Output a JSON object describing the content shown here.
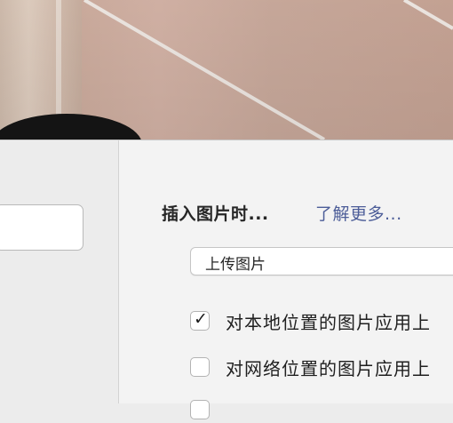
{
  "insert_image": {
    "heading": "插入图片时...",
    "learn_more": "了解更多..."
  },
  "upload_select": {
    "value": "上传图片"
  },
  "checkboxes": [
    {
      "label": "对本地位置的图片应用上",
      "checked": true
    },
    {
      "label": "对网络位置的图片应用上",
      "checked": false
    },
    {
      "label": "",
      "checked": false
    }
  ],
  "icons": {
    "check": "✓"
  },
  "colors": {
    "link": "#4c5d98",
    "panel": "#f3f3f3"
  }
}
